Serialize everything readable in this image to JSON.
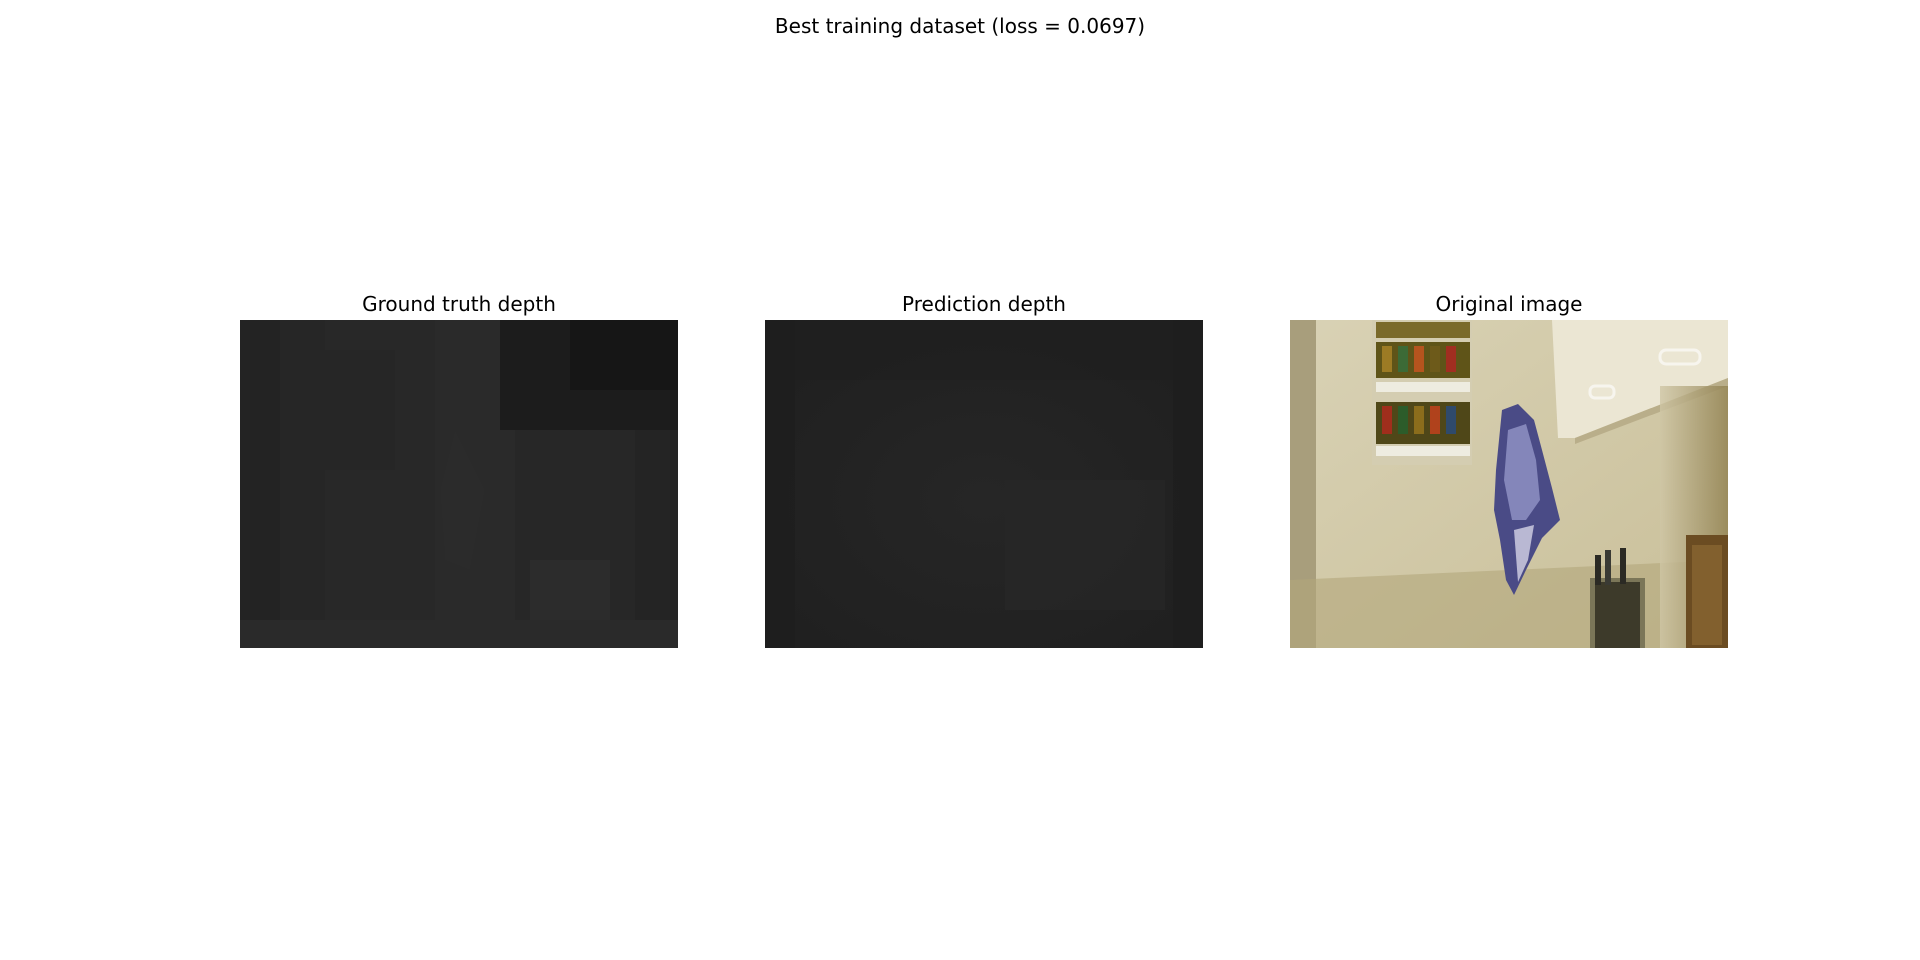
{
  "figure": {
    "title": "Best training dataset (loss = 0.0697)"
  },
  "panels": [
    {
      "title": "Ground truth depth",
      "kind": "depth-map"
    },
    {
      "title": "Prediction depth",
      "kind": "depth-map"
    },
    {
      "title": "Original image",
      "kind": "photo"
    }
  ],
  "colors": {
    "background": "#ffffff",
    "depth_base": "#242424",
    "wall": "#d8d0b4",
    "cabinet": "#e6e1cc"
  }
}
